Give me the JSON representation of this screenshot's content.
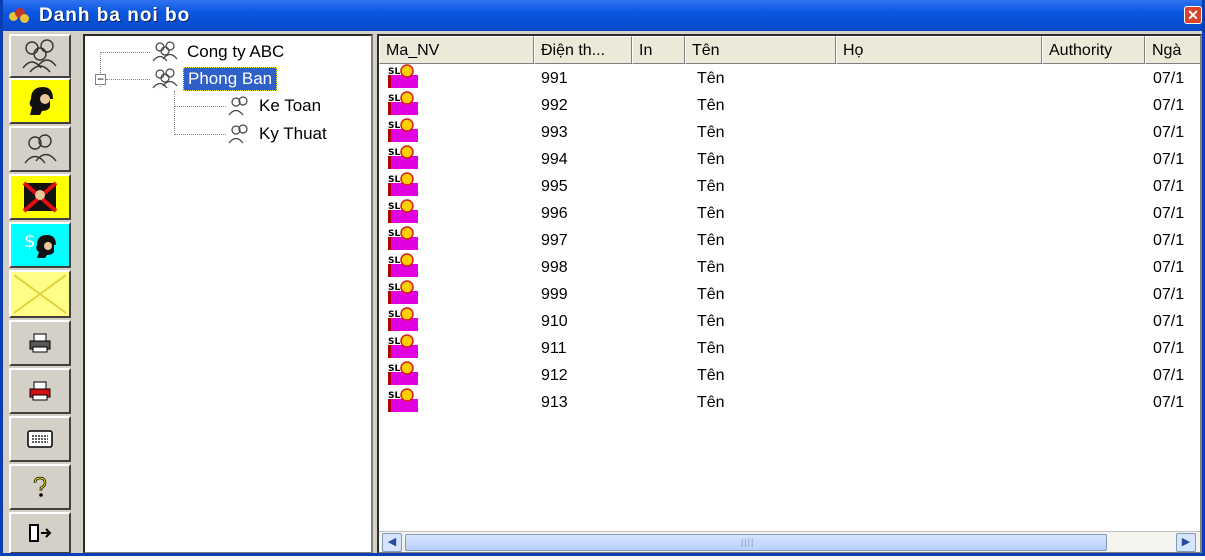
{
  "window": {
    "title": "Danh ba noi bo",
    "close_glyph": "✕"
  },
  "toolbar": {
    "buttons": [
      {
        "name": "group-users-icon"
      },
      {
        "name": "user-icon"
      },
      {
        "name": "users-icon"
      },
      {
        "name": "delete-user-icon"
      },
      {
        "name": "user-money-icon"
      },
      {
        "name": "cancel-icon"
      },
      {
        "name": "printer-icon"
      },
      {
        "name": "printer-red-icon"
      },
      {
        "name": "keyboard-icon"
      },
      {
        "name": "help-icon"
      },
      {
        "name": "exit-door-icon"
      }
    ]
  },
  "tree": {
    "root": "Cong ty ABC",
    "parent": "Phong Ban",
    "children": [
      "Ke Toan",
      "Ky Thuat"
    ],
    "expander_symbol": "−"
  },
  "grid": {
    "columns": [
      "Ma_NV",
      "Điện th...",
      "In",
      "Tên",
      "Họ",
      "Authority",
      "Ngà"
    ],
    "row_icon_text": "SL",
    "rows": [
      {
        "phone": "991",
        "ten": "Tên",
        "ngay": "07/1"
      },
      {
        "phone": "992",
        "ten": "Tên",
        "ngay": "07/1"
      },
      {
        "phone": "993",
        "ten": "Tên",
        "ngay": "07/1"
      },
      {
        "phone": "994",
        "ten": "Tên",
        "ngay": "07/1"
      },
      {
        "phone": "995",
        "ten": "Tên",
        "ngay": "07/1"
      },
      {
        "phone": "996",
        "ten": "Tên",
        "ngay": "07/1"
      },
      {
        "phone": "997",
        "ten": "Tên",
        "ngay": "07/1"
      },
      {
        "phone": "998",
        "ten": "Tên",
        "ngay": "07/1"
      },
      {
        "phone": "999",
        "ten": "Tên",
        "ngay": "07/1"
      },
      {
        "phone": "910",
        "ten": "Tên",
        "ngay": "07/1"
      },
      {
        "phone": "911",
        "ten": "Tên",
        "ngay": "07/1"
      },
      {
        "phone": "912",
        "ten": "Tên",
        "ngay": "07/1"
      },
      {
        "phone": "913",
        "ten": "Tên",
        "ngay": "07/1"
      }
    ]
  },
  "scrollbar": {
    "left_arrow": "◀",
    "right_arrow": "▶",
    "grip": "||||"
  }
}
